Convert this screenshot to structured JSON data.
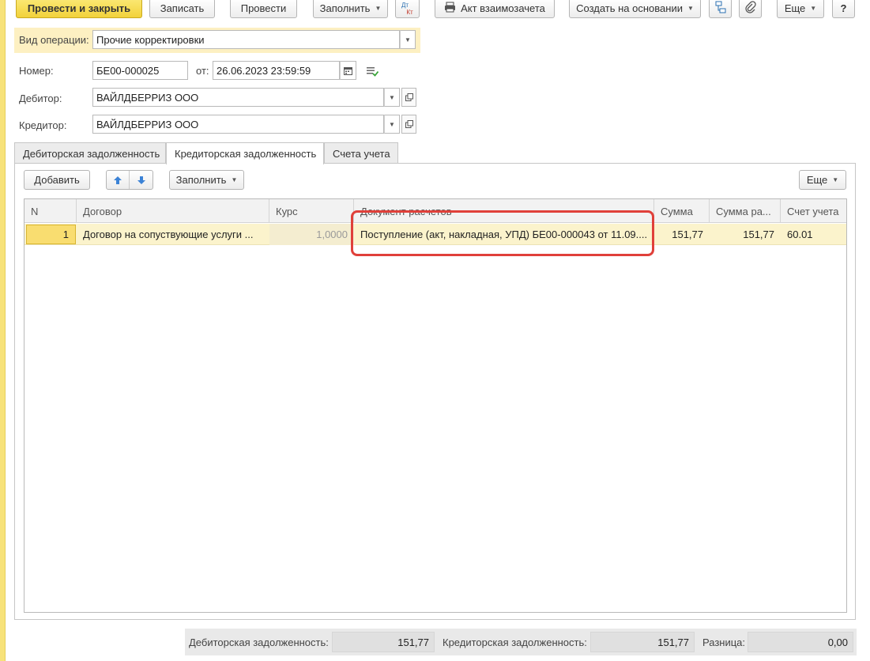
{
  "toolbar": {
    "post_close": "Провести и закрыть",
    "write": "Записать",
    "post": "Провести",
    "fill": "Заполнить",
    "dt_kt_top": "Дт",
    "dt_kt_bottom": "Кт",
    "act": "Акт взаимозачета",
    "create_based": "Создать на основании",
    "more": "Еще",
    "help": "?"
  },
  "form": {
    "operation_label": "Вид операции:",
    "operation_value": "Прочие корректировки",
    "number_label": "Номер:",
    "number_value": "БЕ00-000025",
    "date_label": "от:",
    "date_value": "26.06.2023 23:59:59",
    "debtor_label": "Дебитор:",
    "debtor_value": "ВАЙЛДБЕРРИЗ ООО",
    "creditor_label": "Кредитор:",
    "creditor_value": "ВАЙЛДБЕРРИЗ ООО"
  },
  "tabs": [
    {
      "label": "Дебиторская задолженность",
      "active": false
    },
    {
      "label": "Кредиторская задолженность",
      "active": true
    },
    {
      "label": "Счета учета",
      "active": false
    }
  ],
  "table_toolbar": {
    "add": "Добавить",
    "fill": "Заполнить",
    "more": "Еще"
  },
  "table": {
    "columns": [
      "N",
      "Договор",
      "Курс",
      "Документ расчетов",
      "Сумма",
      "Сумма ра...",
      "Счет учета"
    ],
    "rows": [
      {
        "n": "1",
        "contract": "Договор на сопуствующие услуги ...",
        "rate": "1,0000",
        "document": "Поступление (акт, накладная, УПД) БЕ00-000043 от 11.09....",
        "sum": "151,77",
        "sum_calc": "151,77",
        "account": "60.01"
      }
    ]
  },
  "footer": {
    "debit_label": "Дебиторская задолженность:",
    "debit_value": "151,77",
    "credit_label": "Кредиторская задолженность:",
    "credit_value": "151,77",
    "diff_label": "Разница:",
    "diff_value": "0,00"
  },
  "colors": {
    "accent_yellow": "#f2d23b",
    "row_highlight": "#fbf3cc",
    "annotation_red": "#e0403a"
  }
}
